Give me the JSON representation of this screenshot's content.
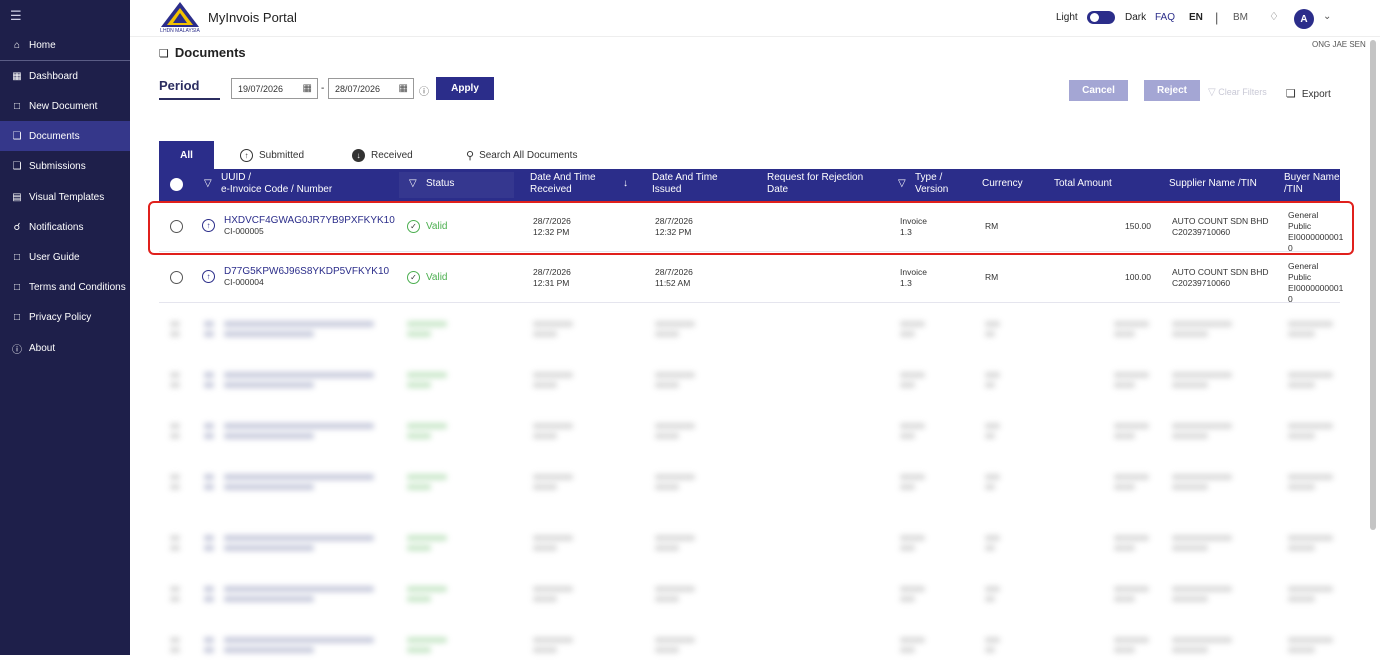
{
  "sidebar": {
    "items": [
      {
        "label": "Home",
        "icon": "home-icon"
      },
      {
        "label": "Dashboard",
        "icon": "dashboard-icon"
      },
      {
        "label": "New Document",
        "icon": "new-document-icon"
      },
      {
        "label": "Documents",
        "icon": "documents-icon"
      },
      {
        "label": "Submissions",
        "icon": "submissions-icon"
      },
      {
        "label": "Visual Templates",
        "icon": "templates-icon"
      },
      {
        "label": "Notifications",
        "icon": "notifications-icon"
      },
      {
        "label": "User Guide",
        "icon": "user-guide-icon"
      },
      {
        "label": "Terms and Conditions",
        "icon": "terms-icon"
      },
      {
        "label": "Privacy Policy",
        "icon": "privacy-icon"
      },
      {
        "label": "About",
        "icon": "info-icon"
      }
    ],
    "active_item": "Documents"
  },
  "header": {
    "logo_text": "LHDN MALAYSIA",
    "app_title": "MyInvois Portal",
    "theme_light": "Light",
    "theme_dark": "Dark",
    "faq": "FAQ",
    "lang_en": "EN",
    "lang_sep": "|",
    "lang_bm": "BM",
    "avatar_letter": "A",
    "username": "ONG JAE SEN"
  },
  "page": {
    "title": "Documents",
    "period_label": "Period",
    "date_from": "19/07/2026",
    "date_sep": "-",
    "date_to": "28/07/2026",
    "apply": "Apply",
    "cancel": "Cancel",
    "reject": "Reject",
    "clear_filters": "Clear Filters",
    "export": "Export"
  },
  "tabs": [
    {
      "label": "All"
    },
    {
      "label": "Submitted"
    },
    {
      "label": "Received"
    },
    {
      "label": "Search All Documents"
    }
  ],
  "table": {
    "columns": {
      "uuid_1": "UUID /",
      "uuid_2": "e-Invoice Code / Number",
      "status": "Status",
      "received_1": "Date And Time",
      "received_2": "Received",
      "issued_1": "Date And Time",
      "issued_2": "Issued",
      "rejection_1": "Request for Rejection",
      "rejection_2": "Date",
      "type_1": "Type /",
      "type_2": "Version",
      "currency": "Currency",
      "total": "Total Amount",
      "supplier_1": "Supplier Name /TIN",
      "buyer_1": "Buyer Name",
      "buyer_2": "/TIN"
    },
    "rows": [
      {
        "uuid": "HXDVCF4GWAG0JR7YB9PXFKYK10",
        "code": "CI-000005",
        "status": "Valid",
        "received_date": "28/7/2026",
        "received_time": "12:32 PM",
        "issued_date": "28/7/2026",
        "issued_time": "12:32 PM",
        "type": "Invoice",
        "version": "1.3",
        "currency": "RM",
        "total": "150.00",
        "supplier_name": "AUTO COUNT SDN BHD",
        "supplier_tin": "C20239710060",
        "buyer_1": "General Public",
        "buyer_2": "EI0000000001",
        "buyer_3": "0"
      },
      {
        "uuid": "D77G5KPW6J96S8YKDP5VFKYK10",
        "code": "CI-000004",
        "status": "Valid",
        "received_date": "28/7/2026",
        "received_time": "12:31 PM",
        "issued_date": "28/7/2026",
        "issued_time": "11:52 AM",
        "type": "Invoice",
        "version": "1.3",
        "currency": "RM",
        "total": "100.00",
        "supplier_name": "AUTO COUNT SDN BHD",
        "supplier_tin": "C20239710060",
        "buyer_1": "General Public",
        "buyer_2": "EI0000000001",
        "buyer_3": "0"
      }
    ]
  },
  "colors": {
    "sidebar": "#1e1f4a",
    "accent": "#2b2d8a",
    "valid": "#4caf50",
    "highlight": "#e0201c"
  }
}
